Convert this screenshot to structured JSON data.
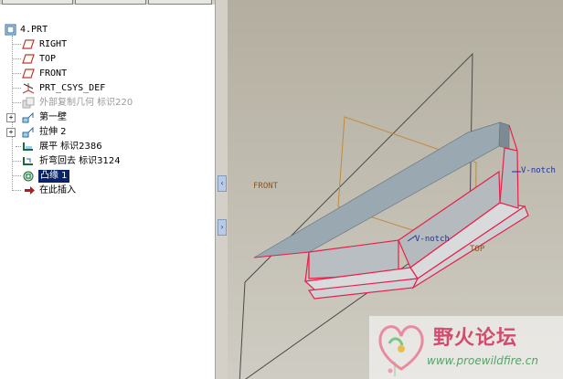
{
  "model_tree": {
    "root": "4.PRT",
    "items": [
      {
        "label": "RIGHT",
        "icon": "datum-plane-icon",
        "style": "mono"
      },
      {
        "label": "TOP",
        "icon": "datum-plane-icon",
        "style": "mono"
      },
      {
        "label": "FRONT",
        "icon": "datum-plane-icon",
        "style": "mono"
      },
      {
        "label": "PRT_CSYS_DEF",
        "icon": "csys-icon",
        "style": "mono"
      },
      {
        "label": "外部复制几何 标识220",
        "icon": "copy-geom-icon",
        "style": "gray"
      },
      {
        "label": "第一壁",
        "icon": "wall-icon",
        "style": "normal"
      },
      {
        "label": "拉伸 2",
        "icon": "extrude-icon",
        "style": "normal"
      },
      {
        "label": "展平 标识2386",
        "icon": "unbend-icon",
        "style": "normal"
      },
      {
        "label": "折弯回去 标识3124",
        "icon": "bendback-icon",
        "style": "normal"
      },
      {
        "label": "凸缘 1",
        "icon": "flange-icon",
        "style": "selected"
      },
      {
        "label": "在此插入",
        "icon": "insert-arrow-icon",
        "style": "normal"
      }
    ]
  },
  "viewport": {
    "datum_labels": {
      "front": "FRONT",
      "top": "TOP"
    },
    "notch_labels": {
      "notch1": "V-notch",
      "notch2": "V-notch"
    }
  },
  "watermark": {
    "title": "野火论坛",
    "url": "www.proewildfire.cn"
  },
  "colors": {
    "selection_bg": "#0a246a",
    "edge_highlight": "#e8204a",
    "datum_plane": "#4a4a4a",
    "top_plane": "#c08a40"
  }
}
